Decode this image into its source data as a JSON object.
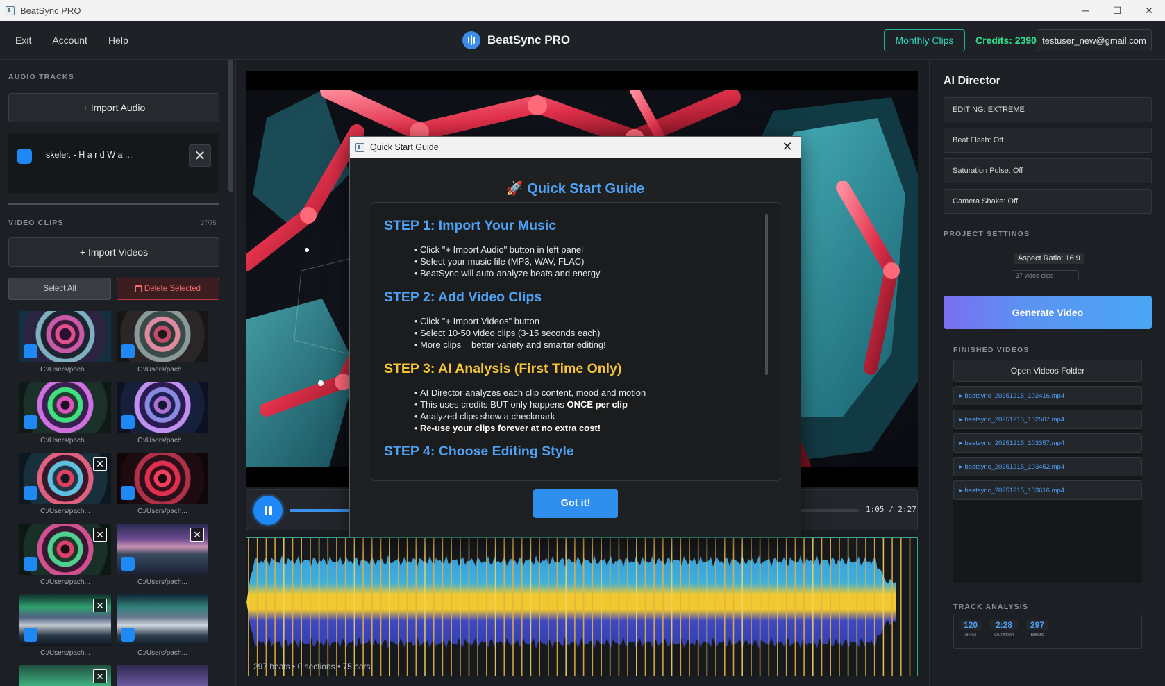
{
  "window": {
    "title": "BeatSync PRO",
    "minimize": "─",
    "maximize": "☐",
    "close": "✕"
  },
  "header": {
    "menu": [
      "Exit",
      "Account",
      "Help"
    ],
    "brand": "BeatSync PRO",
    "monthly_clips": "Monthly Clips",
    "credits": "Credits: 2390",
    "email": "testuser_new@gmail.com"
  },
  "left": {
    "audio_label": "AUDIO TRACKS",
    "import_audio": "+ Import Audio",
    "track_name": "skeler. - H a r d W a ...",
    "track_remove": "✕",
    "video_label": "VIDEO CLIPS",
    "clip_count": "37/75",
    "import_videos": "+ Import Videos",
    "select_all": "Select All",
    "delete_selected": "Delete Selected",
    "clip_path": "C:/Users/pach...",
    "clip_x": "✕"
  },
  "player": {
    "progress": 0.45,
    "time": "1:05 / 2:27",
    "wave_caption": "297 beats • 0 sections • 75 bars"
  },
  "modal": {
    "title": "Quick Start Guide",
    "close": "✕",
    "heading": "🚀 Quick Start Guide",
    "got_it": "Got it!",
    "steps": [
      {
        "title": "STEP 1: Import Your Music",
        "items": [
          "Click \"+ Import Audio\" button in left panel",
          "Select your music file (MP3, WAV, FLAC)",
          "BeatSync will auto-analyze beats and energy"
        ]
      },
      {
        "title": "STEP 2: Add Video Clips",
        "items": [
          "Click \"+ Import Videos\" button",
          "Select 10-50 video clips (3-15 seconds each)",
          "More clips = better variety and smarter editing!"
        ]
      },
      {
        "title": "STEP 3: AI Analysis (First Time Only)",
        "items": [
          "AI Director analyzes each clip content, mood and motion",
          "This uses credits BUT only happens ",
          "ONCE per clip",
          "Analyzed clips show a checkmark",
          "Re-use your clips forever at no extra cost!"
        ]
      },
      {
        "title": "STEP 4: Choose Editing Style"
      }
    ]
  },
  "right": {
    "title": "AI Director",
    "options": [
      "EDITING: EXTREME",
      "Beat Flash: Off",
      "Saturation Pulse: Off",
      "Camera Shake: Off"
    ],
    "project_label": "PROJECT SETTINGS",
    "aspect": "Aspect Ratio: 16:9",
    "clips": "37 video clips",
    "generate": "Generate Video",
    "finished_label": "FINISHED VIDEOS",
    "open_folder": "Open Videos Folder",
    "videos": [
      "▸ beatsync_20251215_102416.mp4",
      "▸ beatsync_20251215_102507.mp4",
      "▸ beatsync_20251215_103357.mp4",
      "▸ beatsync_20251215_103452.mp4",
      "▸ beatsync_20251215_103616.mp4"
    ],
    "analysis_label": "TRACK ANALYSIS",
    "stats": [
      {
        "value": "120",
        "label": "BPM"
      },
      {
        "value": "2:28",
        "label": "Duration"
      },
      {
        "value": "297",
        "label": "Beats"
      }
    ]
  },
  "colors": {
    "accent": "#1e88f5",
    "credits": "#2ee08e",
    "teal": "#21b7a2",
    "danger": "#c2393e",
    "step_blue": "#4fa1f3",
    "step_gold": "#f5c537"
  }
}
